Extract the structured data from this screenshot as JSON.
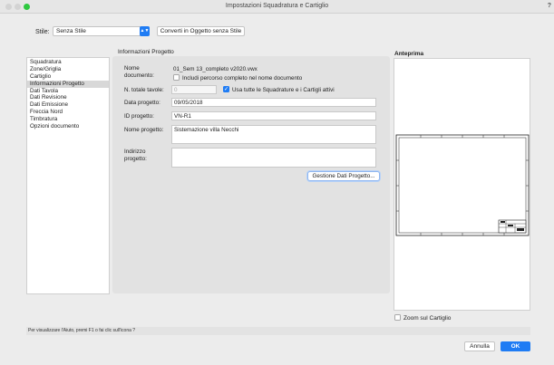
{
  "window": {
    "title": "Impostazioni Squadratura e Cartiglio",
    "help_mark": "?"
  },
  "style_row": {
    "label": "Stile:",
    "selected_value": "Senza Stile",
    "convert_button": "Converti in Oggetto senza Stile"
  },
  "sidebar": {
    "items": [
      {
        "label": "Squadratura"
      },
      {
        "label": "Zone/Griglia"
      },
      {
        "label": "Cartiglio"
      },
      {
        "label": "Informazioni Progetto"
      },
      {
        "label": "Dati Tavola"
      },
      {
        "label": "Dati Revisione"
      },
      {
        "label": "Dati Emissione"
      },
      {
        "label": "Freccia Nord"
      },
      {
        "label": "Timbratura"
      },
      {
        "label": "Opzioni documento"
      }
    ]
  },
  "project_info": {
    "group_title": "Informazioni Progetto",
    "doc_name_label": "Nome documento:",
    "doc_name_value": "01_Sem 13_completo v2020.vwx",
    "include_path_label": "Includi percorso completo nel nome documento",
    "total_sheets_label": "N. totale tavole:",
    "total_sheets_value": "0",
    "use_all_label": "Usa tutte le Squadrature e i Cartigli attivi",
    "date_label": "Data progetto:",
    "date_value": "09/05/2018",
    "id_label": "ID progetto:",
    "id_value": "VN-R1",
    "name_label": "Nome progetto:",
    "name_value": "Sistemazione villa Necchi",
    "address_label": "Indirizzo progetto:",
    "address_value": "",
    "manage_button": "Gestione Dati Progetto..."
  },
  "preview": {
    "label": "Anteprima",
    "zoom_label": "Zoom sul Cartiglio"
  },
  "status_text": "Per visualizzare l'Aiuto, premi F1 o fai clic sull'icona ?",
  "footer": {
    "cancel": "Annulla",
    "ok": "OK"
  }
}
